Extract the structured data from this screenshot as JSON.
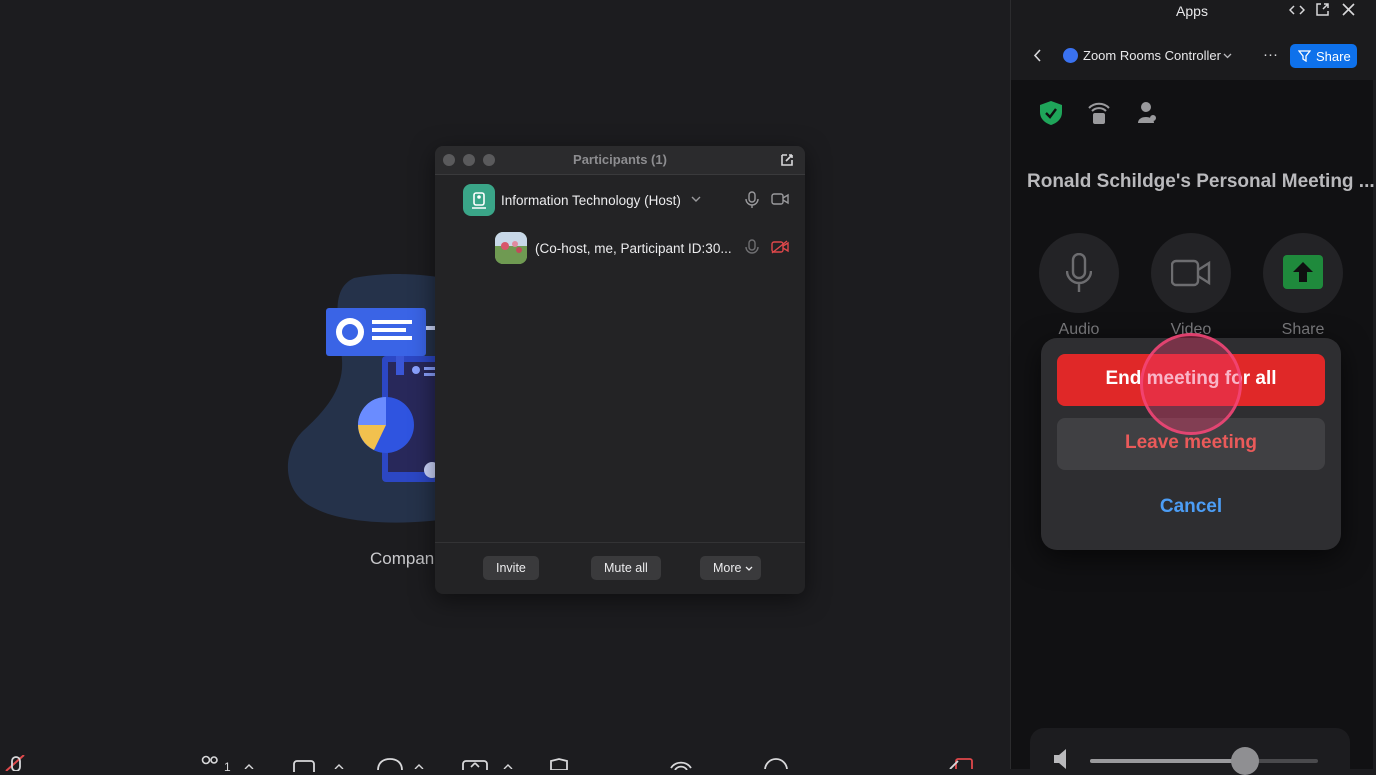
{
  "companion": {
    "label": "Compani"
  },
  "participants_window": {
    "title": "Participants (1)",
    "rows": [
      {
        "name": "Information Technology (Host)"
      },
      {
        "name": "(Co-host, me, Participant ID:30..."
      }
    ],
    "buttons": {
      "invite": "Invite",
      "mute_all": "Mute all",
      "more": "More"
    }
  },
  "right_panel": {
    "header_title": "Apps",
    "app_name": "Zoom Rooms Controller",
    "share_label": "Share",
    "meeting_title": "Ronald Schildge's Personal Meeting ...",
    "controls": [
      {
        "label": "Audio"
      },
      {
        "label": "Video"
      },
      {
        "label": "Share"
      }
    ],
    "dialog": {
      "end_all": "End meeting for all",
      "leave": "Leave meeting",
      "cancel": "Cancel"
    },
    "volume_level": 0.68
  },
  "toolbar": {
    "participants_count": "1"
  },
  "colors": {
    "background": "#1c1c1f",
    "accent_blue": "#0e71eb",
    "danger_red": "#e02828",
    "leave_red": "#ea5a5a",
    "cancel_blue": "#4c9df5",
    "shield_green": "#1fa55a",
    "share_green": "#1f8a3c",
    "click_marker": "#f0467a"
  }
}
